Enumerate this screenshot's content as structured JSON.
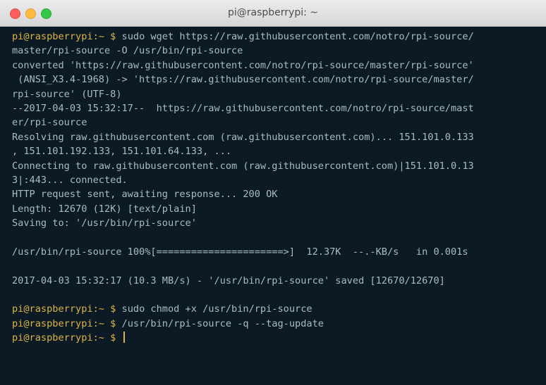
{
  "window": {
    "title": "pi@raspberrypi: ~"
  },
  "colors": {
    "background": "#0b1a24",
    "text": "#a7bdc6",
    "prompt": "#dcb446",
    "close": "#fc605c",
    "minimize": "#fdbc40",
    "maximize": "#34c84a"
  },
  "terminal": {
    "prompt": "pi@raspberrypi:~ $",
    "lines": [
      {
        "type": "command",
        "text": "sudo wget https://raw.githubusercontent.com/notro/rpi-source/"
      },
      {
        "type": "output",
        "text": "master/rpi-source -O /usr/bin/rpi-source"
      },
      {
        "type": "output",
        "text": "converted 'https://raw.githubusercontent.com/notro/rpi-source/master/rpi-source'"
      },
      {
        "type": "output",
        "text": " (ANSI_X3.4-1968) -> 'https://raw.githubusercontent.com/notro/rpi-source/master/"
      },
      {
        "type": "output",
        "text": "rpi-source' (UTF-8)"
      },
      {
        "type": "output",
        "text": "--2017-04-03 15:32:17--  https://raw.githubusercontent.com/notro/rpi-source/mast"
      },
      {
        "type": "output",
        "text": "er/rpi-source"
      },
      {
        "type": "output",
        "text": "Resolving raw.githubusercontent.com (raw.githubusercontent.com)... 151.101.0.133"
      },
      {
        "type": "output",
        "text": ", 151.101.192.133, 151.101.64.133, ..."
      },
      {
        "type": "output",
        "text": "Connecting to raw.githubusercontent.com (raw.githubusercontent.com)|151.101.0.13"
      },
      {
        "type": "output",
        "text": "3|:443... connected."
      },
      {
        "type": "output",
        "text": "HTTP request sent, awaiting response... 200 OK"
      },
      {
        "type": "output",
        "text": "Length: 12670 (12K) [text/plain]"
      },
      {
        "type": "output",
        "text": "Saving to: '/usr/bin/rpi-source'"
      },
      {
        "type": "output",
        "text": ""
      },
      {
        "type": "output",
        "text": "/usr/bin/rpi-source 100%[======================>]  12.37K  --.-KB/s   in 0.001s"
      },
      {
        "type": "output",
        "text": ""
      },
      {
        "type": "output",
        "text": "2017-04-03 15:32:17 (10.3 MB/s) - '/usr/bin/rpi-source' saved [12670/12670]"
      },
      {
        "type": "output",
        "text": ""
      },
      {
        "type": "command",
        "text": "sudo chmod +x /usr/bin/rpi-source"
      },
      {
        "type": "command",
        "text": "/usr/bin/rpi-source -q --tag-update"
      },
      {
        "type": "command",
        "text": "",
        "cursor": true
      }
    ]
  }
}
